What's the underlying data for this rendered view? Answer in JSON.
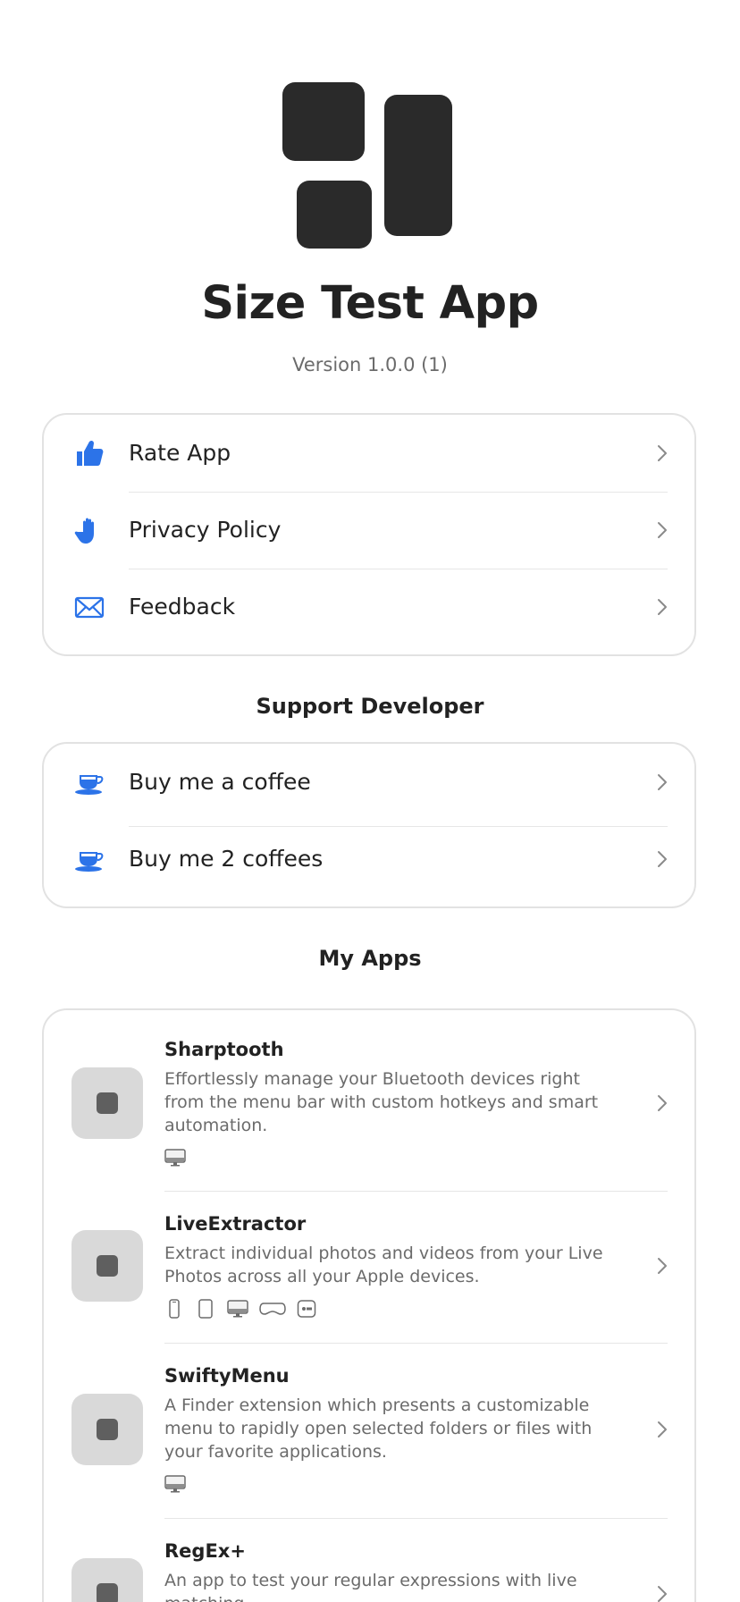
{
  "header": {
    "title": "Size Test App",
    "version": "Version 1.0.0 (1)",
    "logo_icon": "app-logo-icon"
  },
  "info_card": {
    "items": [
      {
        "label": "Rate App",
        "icon": "thumbs-up-icon"
      },
      {
        "label": "Privacy Policy",
        "icon": "hand-raised-icon"
      },
      {
        "label": "Feedback",
        "icon": "envelope-icon"
      }
    ]
  },
  "support": {
    "title": "Support Developer",
    "items": [
      {
        "label": "Buy me a coffee",
        "icon": "coffee-cup-icon"
      },
      {
        "label": "Buy me 2 coffees",
        "icon": "coffee-cup-icon"
      }
    ]
  },
  "my_apps": {
    "title": "My Apps",
    "apps": [
      {
        "name": "Sharptooth",
        "description": "Effortlessly manage your Bluetooth devices right from the menu bar with custom hotkeys and smart automation.",
        "platforms": [
          "mac"
        ]
      },
      {
        "name": "LiveExtractor",
        "description": "Extract individual photos and videos from your Live Photos across all your Apple devices.",
        "platforms": [
          "iphone",
          "ipad",
          "mac",
          "vision",
          "tv"
        ]
      },
      {
        "name": "SwiftyMenu",
        "description": "A Finder extension which presents a customizable menu to rapidly open selected folders or files with your favorite applications.",
        "platforms": [
          "mac"
        ]
      },
      {
        "name": "RegEx+",
        "description": "An app to test your regular expressions with live matching.",
        "platforms": []
      }
    ]
  },
  "colors": {
    "accent": "#2C73E8",
    "text": "#222222",
    "secondary_text": "#6B6B6B",
    "border": "#E2E2E2"
  }
}
